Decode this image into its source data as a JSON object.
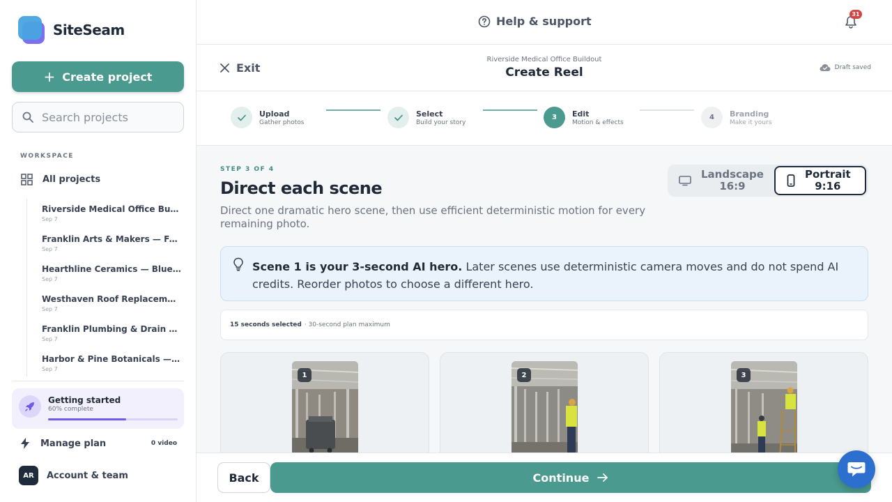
{
  "app": {
    "name": "SiteSeam"
  },
  "sidebar": {
    "create_label": "Create project",
    "search_placeholder": "Search projects",
    "workspace_label": "WORKSPACE",
    "all_projects_label": "All projects",
    "projects": [
      {
        "name": "Riverside Medical Office Buildout",
        "date": "Sep 7"
      },
      {
        "name": "Franklin Arts & Makers — Fall C...",
        "date": "Sep 7"
      },
      {
        "name": "Hearthline Ceramics — Blue Rid...",
        "date": "Sep 7"
      },
      {
        "name": "Westhaven Roof Replacement",
        "date": "Sep 7"
      },
      {
        "name": "Franklin Plumbing & Drain — Jo...",
        "date": "Sep 7"
      },
      {
        "name": "Harbor & Pine Botanicals — Coa...",
        "date": "Sep 7"
      }
    ],
    "getting_started": {
      "title": "Getting started",
      "subtitle": "60% complete",
      "progress": 0.6
    },
    "manage_plan": {
      "label": "Manage plan",
      "count": "0 video"
    },
    "account": {
      "initials": "AR",
      "label": "Account & team"
    }
  },
  "topbar": {
    "help_label": "Help & support",
    "notification_count": "31"
  },
  "header": {
    "exit_label": "Exit",
    "project_name": "Riverside Medical Office Buildout",
    "title": "Create Reel",
    "draft_status": "Draft saved"
  },
  "stepper": {
    "steps": [
      {
        "number": "1",
        "title": "Upload",
        "subtitle": "Gather photos",
        "state": "done"
      },
      {
        "number": "2",
        "title": "Select",
        "subtitle": "Build your story",
        "state": "done"
      },
      {
        "number": "3",
        "title": "Edit",
        "subtitle": "Motion & effects",
        "state": "active"
      },
      {
        "number": "4",
        "title": "Branding",
        "subtitle": "Make it yours",
        "state": "todo"
      }
    ]
  },
  "main": {
    "step_label": "STEP 3 OF 4",
    "heading": "Direct each scene",
    "description": "Direct one dramatic hero scene, then use efficient deterministic motion for every remaining photo.",
    "orientation": {
      "landscape": {
        "label": "Landscape",
        "ratio": "16:9"
      },
      "portrait": {
        "label": "Portrait",
        "ratio": "9:16"
      },
      "selected": "portrait"
    },
    "hero_notice": {
      "bold": "Scene 1 is your 3-second AI hero.",
      "text": " Later scenes use deterministic camera moves and do not spend AI credits. Reorder photos to choose a different hero."
    },
    "selection": {
      "selected": "15 seconds selected",
      "limit": "· 30-second plan maximum"
    },
    "scenes": [
      {
        "number": "1"
      },
      {
        "number": "2"
      },
      {
        "number": "3"
      }
    ]
  },
  "footer": {
    "back_label": "Back",
    "continue_label": "Continue"
  },
  "colors": {
    "accent": "#4a9a8f",
    "badge": "#d64545",
    "chat": "#2d6fcf",
    "progress": "#6d5ce6"
  }
}
